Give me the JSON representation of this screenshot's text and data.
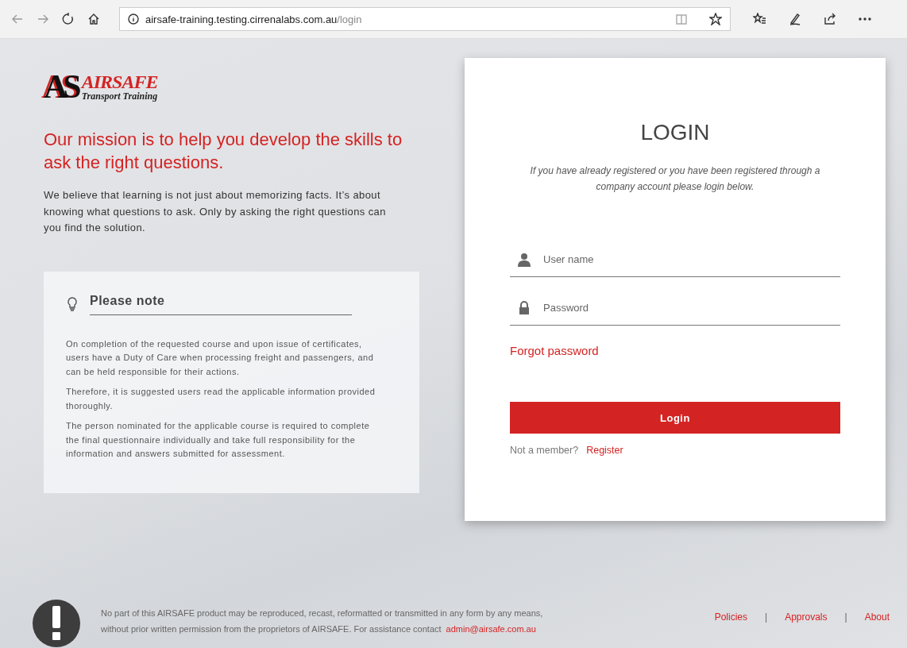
{
  "browser": {
    "url_host": "airsafe-training.testing.cirrenalabs.com.au",
    "url_path": "/login"
  },
  "brand": {
    "monogram": "AS",
    "name": "AIRSAFE",
    "tagline": "Transport Training"
  },
  "mission": {
    "heading": "Our mission is to help you develop the skills to ask the right questions.",
    "body": "We believe that learning is not just about memorizing facts. It’s about knowing what questions to ask. Only by asking the right questions can you find the solution."
  },
  "note": {
    "title": "Please note",
    "paragraphs": [
      "On completion of the requested course and upon issue of certificates, users have a Duty of Care when processing freight and passengers, and can be held responsible for their actions.",
      "Therefore, it is suggested users read the applicable information provided thoroughly.",
      "The person nominated for the applicable course is required to complete the final questionnaire individually and take full responsibility for the information and answers submitted for assessment."
    ]
  },
  "login": {
    "title": "LOGIN",
    "intro": "If you have already registered or you have been registered through a company account please login below.",
    "fields": [
      {
        "kind": "user",
        "placeholder": "User name"
      },
      {
        "kind": "password",
        "placeholder": "Password"
      }
    ],
    "forgot": "Forgot password",
    "button": "Login",
    "member_prompt": "Not a member?",
    "register": "Register"
  },
  "footer": {
    "notice_line1": "No part of this AIRSAFE product may be reproduced, recast, reformatted or transmitted in any form by any means,",
    "notice_line2": "without prior written permission from the proprietors of AIRSAFE. For assistance contact",
    "email": "admin@airsafe.com.au",
    "links": [
      "Policies",
      "Approvals",
      "About"
    ],
    "separator": "|"
  }
}
